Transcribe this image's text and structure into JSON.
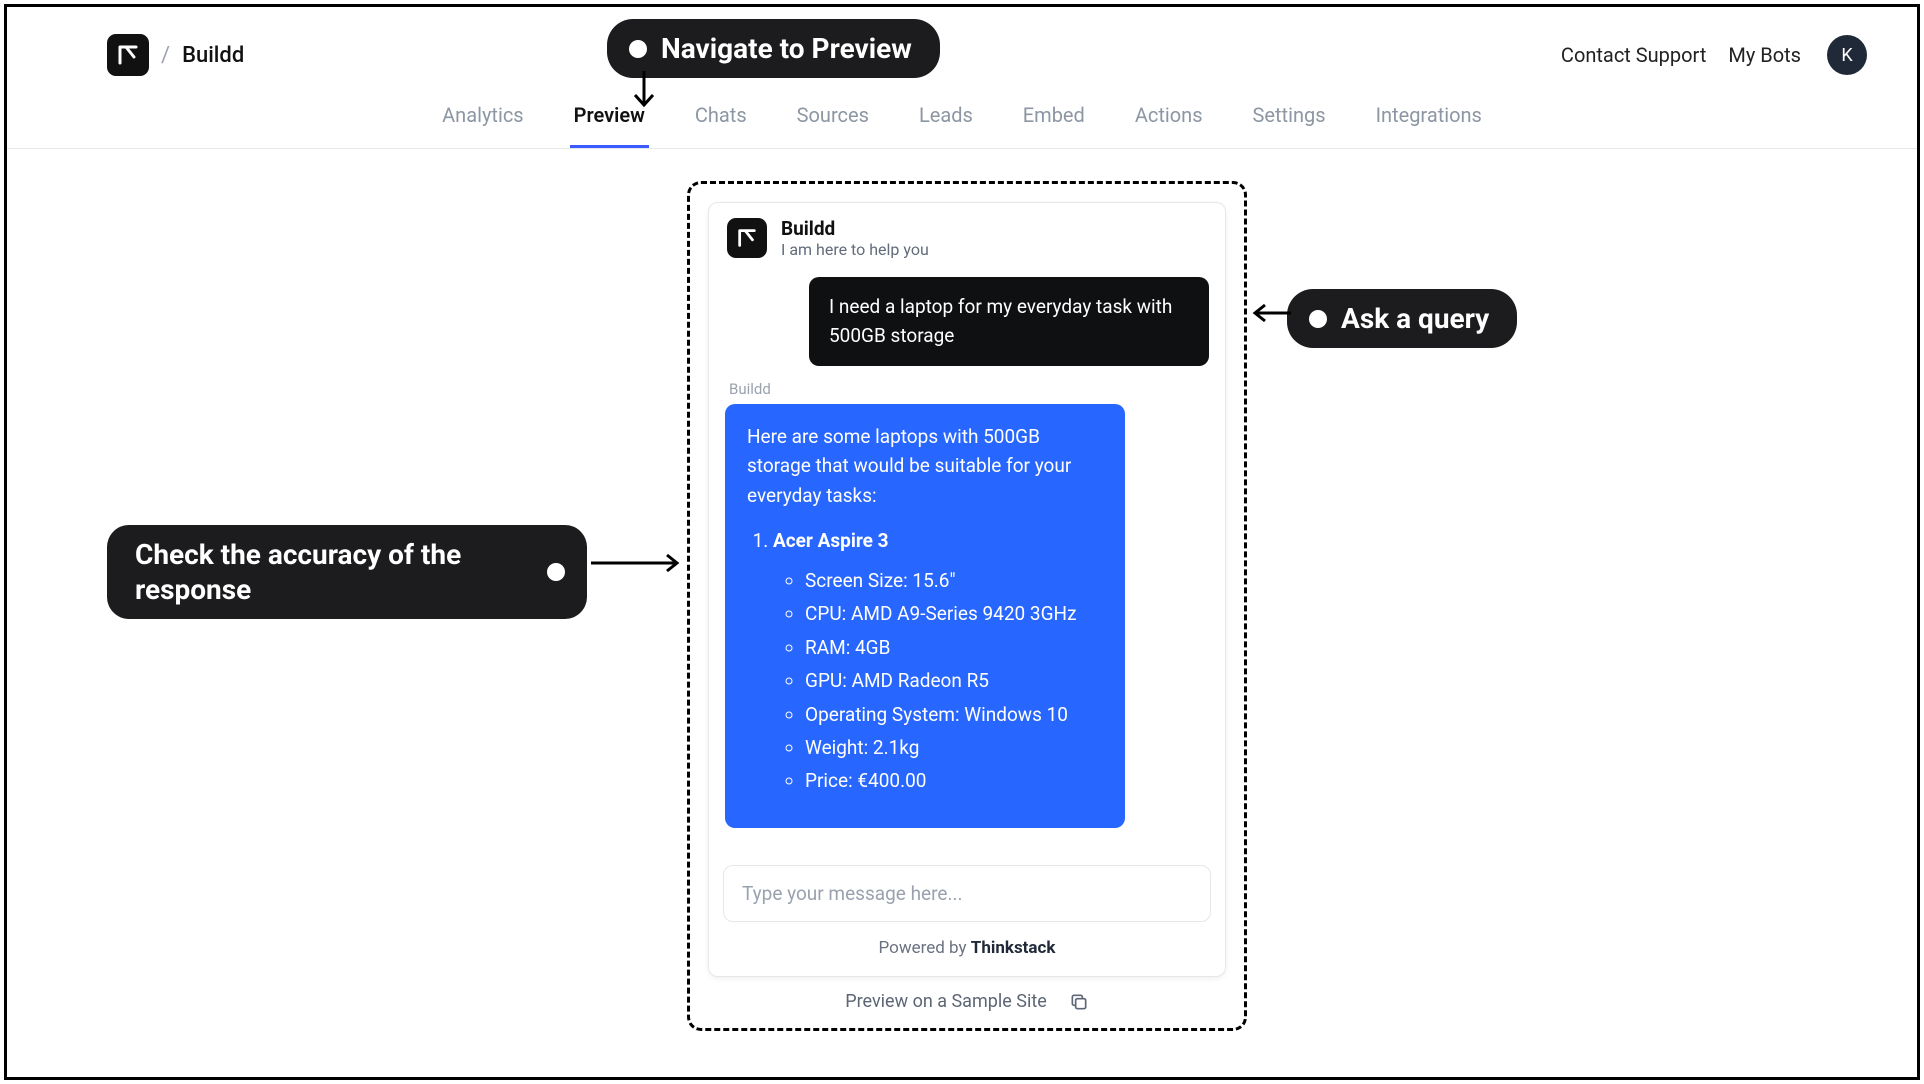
{
  "header": {
    "project_name": "Buildd",
    "contact_support": "Contact Support",
    "my_bots": "My Bots",
    "avatar_initial": "K"
  },
  "tabs": [
    {
      "id": "analytics",
      "label": "Analytics",
      "active": false
    },
    {
      "id": "preview",
      "label": "Preview",
      "active": true
    },
    {
      "id": "chats",
      "label": "Chats",
      "active": false
    },
    {
      "id": "sources",
      "label": "Sources",
      "active": false
    },
    {
      "id": "leads",
      "label": "Leads",
      "active": false
    },
    {
      "id": "embed",
      "label": "Embed",
      "active": false
    },
    {
      "id": "actions",
      "label": "Actions",
      "active": false
    },
    {
      "id": "settings",
      "label": "Settings",
      "active": false
    },
    {
      "id": "integrations",
      "label": "Integrations",
      "active": false
    }
  ],
  "chat": {
    "title": "Buildd",
    "subtitle": "I am here to help you",
    "user_message": "I need a laptop for my everyday task with 500GB storage",
    "bot_label": "Buildd",
    "bot_intro": "Here are some laptops with 500GB storage that would be suitable for your everyday tasks:",
    "product": {
      "name": "Acer Aspire 3",
      "specs": [
        "Screen Size: 15.6\"",
        "CPU: AMD A9-Series 9420 3GHz",
        "RAM: 4GB",
        "GPU: AMD Radeon R5",
        "Operating System: Windows 10",
        "Weight: 2.1kg",
        "Price: €400.00"
      ]
    },
    "input_placeholder": "Type your message here...",
    "powered_prefix": "Powered by ",
    "powered_brand": "Thinkstack",
    "preview_site": "Preview on a Sample Site"
  },
  "annotations": {
    "nav_preview": "Navigate to Preview",
    "ask_query": "Ask a query",
    "check_response": "Check the accuracy of the response"
  }
}
